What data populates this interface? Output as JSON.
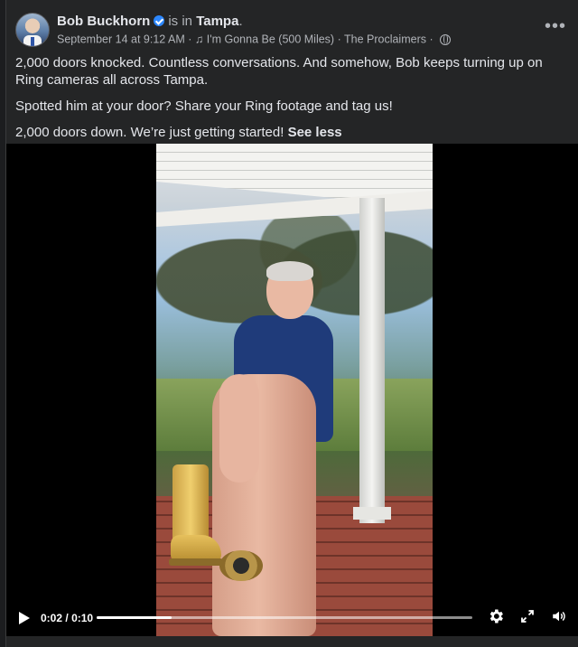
{
  "post": {
    "author": "Bob Buckhorn",
    "is_in": "is in",
    "place": "Tampa",
    "period": ".",
    "date": "September 14 at 9:12 AM",
    "separator": "·",
    "music": "I'm Gonna Be (500 Miles) · The Proclaimers",
    "privacy_icon": "globe-icon",
    "more_icon": "more-options-icon"
  },
  "text": {
    "p1": "2,000 doors knocked. Countless conversations. And somehow, Bob keeps turning up on Ring cameras all across Tampa.",
    "p2": "Spotted him at your door? Share your Ring footage and tag us!",
    "p3": "2,000 doors down. We’re just getting started!",
    "see_less": "See less"
  },
  "video": {
    "current_time": "0:02",
    "divider": "/",
    "duration": "0:10",
    "progress_fraction": 0.2
  },
  "colors": {
    "accent": "#2d88ff",
    "background": "#242526",
    "text": "#e4e6eb",
    "muted": "#b0b3b8"
  }
}
